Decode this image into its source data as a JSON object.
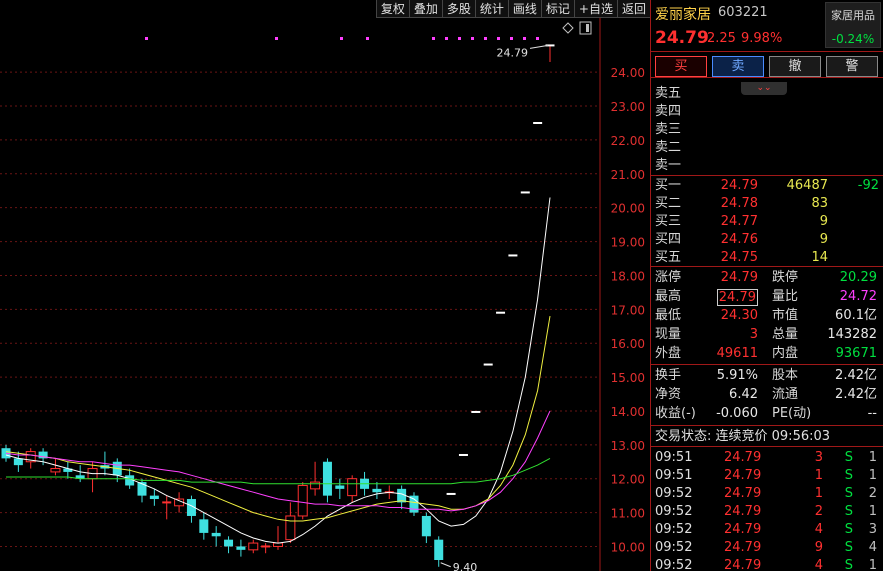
{
  "toolbar": [
    "复权",
    "叠加",
    "多股",
    "统计",
    "画线",
    "标记",
    "+自选",
    "返回"
  ],
  "stock": {
    "name": "爱丽家居",
    "code": "603221",
    "price": "24.79",
    "change": "2.25",
    "pct": "9.98%",
    "sector": "家居用品",
    "sector_change": "-0.24%"
  },
  "trade_buttons": [
    "买",
    "卖",
    "撤",
    "警"
  ],
  "asks": [
    {
      "label": "卖五",
      "price": "",
      "vol": "",
      "chg": ""
    },
    {
      "label": "卖四",
      "price": "",
      "vol": "",
      "chg": ""
    },
    {
      "label": "卖三",
      "price": "",
      "vol": "",
      "chg": ""
    },
    {
      "label": "卖二",
      "price": "",
      "vol": "",
      "chg": ""
    },
    {
      "label": "卖一",
      "price": "",
      "vol": "",
      "chg": ""
    }
  ],
  "bids": [
    {
      "label": "买一",
      "price": "24.79",
      "vol": "46487",
      "chg": "-92"
    },
    {
      "label": "买二",
      "price": "24.78",
      "vol": "83",
      "chg": ""
    },
    {
      "label": "买三",
      "price": "24.77",
      "vol": "9",
      "chg": ""
    },
    {
      "label": "买四",
      "price": "24.76",
      "vol": "9",
      "chg": ""
    },
    {
      "label": "买五",
      "price": "24.75",
      "vol": "14",
      "chg": ""
    }
  ],
  "stats": {
    "limit_up_label": "涨停",
    "limit_up": "24.79",
    "limit_down_label": "跌停",
    "limit_down": "20.29",
    "high_label": "最高",
    "high": "24.79",
    "vol_ratio_label": "量比",
    "vol_ratio": "24.72",
    "low_label": "最低",
    "low": "24.30",
    "mkt_cap_label": "市值",
    "mkt_cap": "60.1亿",
    "cur_vol_label": "现量",
    "cur_vol": "3",
    "total_vol_label": "总量",
    "total_vol": "143282",
    "outer_label": "外盘",
    "outer": "49611",
    "inner_label": "内盘",
    "inner": "93671"
  },
  "stats2": {
    "turnover_label": "换手",
    "turnover": "5.91%",
    "shares_label": "股本",
    "shares": "2.42亿",
    "nav_label": "净资",
    "nav": "6.42",
    "float_label": "流通",
    "float": "2.42亿",
    "eps_label": "收益(-)",
    "eps": "-0.060",
    "pe_label": "PE(动)",
    "pe": "--"
  },
  "status_line": "交易状态: 连续竞价 09:56:03",
  "ticks": [
    {
      "time": "09:51",
      "price": "24.79",
      "vol": "3",
      "side": "S",
      "num": "1"
    },
    {
      "time": "09:51",
      "price": "24.79",
      "vol": "1",
      "side": "S",
      "num": "1"
    },
    {
      "time": "09:52",
      "price": "24.79",
      "vol": "1",
      "side": "S",
      "num": "2"
    },
    {
      "time": "09:52",
      "price": "24.79",
      "vol": "2",
      "side": "S",
      "num": "1"
    },
    {
      "time": "09:52",
      "price": "24.79",
      "vol": "4",
      "side": "S",
      "num": "3"
    },
    {
      "time": "09:52",
      "price": "24.79",
      "vol": "9",
      "side": "S",
      "num": "4"
    },
    {
      "time": "09:52",
      "price": "24.79",
      "vol": "4",
      "side": "S",
      "num": "1"
    }
  ],
  "colors": {
    "up": "#ff3030",
    "down": "#3fe0e0",
    "ma1": "#ffffff",
    "ma2": "#f0f040",
    "ma3": "#ff40ff",
    "ma4": "#30e030"
  },
  "chart_data": {
    "type": "candlestick",
    "y_ticks": [
      "24.00",
      "23.00",
      "22.00",
      "21.00",
      "20.00",
      "19.00",
      "18.00",
      "17.00",
      "16.00",
      "15.00",
      "14.00",
      "13.00",
      "12.00",
      "11.00",
      "10.00"
    ],
    "ylim": [
      9.6,
      24.95
    ],
    "annotations": {
      "high": "24.79",
      "low": "9.40"
    },
    "candles": [
      {
        "o": 12.9,
        "c": 12.6,
        "h": 13.0,
        "l": 12.5
      },
      {
        "o": 12.6,
        "c": 12.4,
        "h": 12.8,
        "l": 12.2
      },
      {
        "o": 12.5,
        "c": 12.8,
        "h": 12.9,
        "l": 12.3
      },
      {
        "o": 12.8,
        "c": 12.6,
        "h": 12.9,
        "l": 12.4
      },
      {
        "o": 12.2,
        "c": 12.3,
        "h": 12.6,
        "l": 12.1
      },
      {
        "o": 12.3,
        "c": 12.2,
        "h": 12.5,
        "l": 12.0
      },
      {
        "o": 12.1,
        "c": 12.0,
        "h": 12.4,
        "l": 11.9
      },
      {
        "o": 12.0,
        "c": 12.3,
        "h": 12.5,
        "l": 11.6
      },
      {
        "o": 12.4,
        "c": 12.3,
        "h": 12.8,
        "l": 12.1
      },
      {
        "o": 12.5,
        "c": 12.1,
        "h": 12.6,
        "l": 11.9
      },
      {
        "o": 12.1,
        "c": 11.8,
        "h": 12.3,
        "l": 11.7
      },
      {
        "o": 11.9,
        "c": 11.5,
        "h": 12.0,
        "l": 11.3
      },
      {
        "o": 11.5,
        "c": 11.4,
        "h": 11.7,
        "l": 11.2
      },
      {
        "o": 11.3,
        "c": 11.3,
        "h": 11.5,
        "l": 10.8
      },
      {
        "o": 11.2,
        "c": 11.4,
        "h": 11.6,
        "l": 11.0
      },
      {
        "o": 11.4,
        "c": 10.9,
        "h": 11.5,
        "l": 10.7
      },
      {
        "o": 10.8,
        "c": 10.4,
        "h": 11.0,
        "l": 10.2
      },
      {
        "o": 10.4,
        "c": 10.3,
        "h": 10.6,
        "l": 10.0
      },
      {
        "o": 10.2,
        "c": 10.0,
        "h": 10.3,
        "l": 9.8
      },
      {
        "o": 10.0,
        "c": 9.9,
        "h": 10.2,
        "l": 9.7
      },
      {
        "o": 9.9,
        "c": 10.1,
        "h": 10.2,
        "l": 9.8
      },
      {
        "o": 10.0,
        "c": 10.0,
        "h": 10.1,
        "l": 9.8
      },
      {
        "o": 10.0,
        "c": 10.1,
        "h": 10.6,
        "l": 9.9
      },
      {
        "o": 10.2,
        "c": 10.9,
        "h": 11.3,
        "l": 10.1
      },
      {
        "o": 10.9,
        "c": 11.8,
        "h": 11.9,
        "l": 10.8
      },
      {
        "o": 11.7,
        "c": 11.9,
        "h": 12.5,
        "l": 11.5
      },
      {
        "o": 12.5,
        "c": 11.5,
        "h": 12.6,
        "l": 11.3
      },
      {
        "o": 11.8,
        "c": 11.7,
        "h": 12.0,
        "l": 11.4
      },
      {
        "o": 11.5,
        "c": 12.0,
        "h": 12.1,
        "l": 11.3
      },
      {
        "o": 12.0,
        "c": 11.7,
        "h": 12.2,
        "l": 11.5
      },
      {
        "o": 11.7,
        "c": 11.6,
        "h": 11.9,
        "l": 11.4
      },
      {
        "o": 11.6,
        "c": 11.6,
        "h": 11.8,
        "l": 11.4
      },
      {
        "o": 11.7,
        "c": 11.3,
        "h": 11.8,
        "l": 11.1
      },
      {
        "o": 11.5,
        "c": 11.0,
        "h": 11.6,
        "l": 10.9
      },
      {
        "o": 10.9,
        "c": 10.3,
        "h": 11.0,
        "l": 10.1
      },
      {
        "o": 10.2,
        "c": 9.6,
        "h": 10.3,
        "l": 9.4
      },
      {
        "o": 11.55,
        "c": 11.55,
        "h": 11.55,
        "l": 11.55
      },
      {
        "o": 12.7,
        "c": 12.7,
        "h": 12.7,
        "l": 12.7
      },
      {
        "o": 13.97,
        "c": 13.97,
        "h": 13.97,
        "l": 13.97
      },
      {
        "o": 15.37,
        "c": 15.37,
        "h": 15.37,
        "l": 15.37
      },
      {
        "o": 16.9,
        "c": 16.9,
        "h": 16.9,
        "l": 16.9
      },
      {
        "o": 18.59,
        "c": 18.59,
        "h": 18.59,
        "l": 18.59
      },
      {
        "o": 20.45,
        "c": 20.45,
        "h": 20.45,
        "l": 20.45
      },
      {
        "o": 22.5,
        "c": 22.5,
        "h": 22.5,
        "l": 22.5
      },
      {
        "o": 24.79,
        "c": 24.79,
        "h": 24.79,
        "l": 24.3
      }
    ],
    "ma": [
      {
        "name": "ma1",
        "values": [
          12.7,
          12.6,
          12.55,
          12.5,
          12.4,
          12.3,
          12.2,
          12.15,
          12.15,
          12.1,
          12.0,
          11.85,
          11.7,
          11.5,
          11.35,
          11.2,
          11.0,
          10.8,
          10.6,
          10.4,
          10.25,
          10.15,
          10.1,
          10.15,
          10.35,
          10.6,
          10.9,
          11.1,
          11.3,
          11.45,
          11.55,
          11.6,
          11.55,
          11.4,
          11.1,
          10.75,
          10.6,
          10.65,
          10.9,
          11.4,
          12.2,
          13.4,
          15.0,
          17.3,
          20.3
        ]
      },
      {
        "name": "ma2",
        "values": [
          12.8,
          12.75,
          12.7,
          12.65,
          12.6,
          12.5,
          12.45,
          12.4,
          12.35,
          12.3,
          12.25,
          12.15,
          12.05,
          11.95,
          11.85,
          11.75,
          11.6,
          11.45,
          11.3,
          11.15,
          11.0,
          10.9,
          10.8,
          10.75,
          10.75,
          10.8,
          10.85,
          10.95,
          11.05,
          11.15,
          11.25,
          11.3,
          11.35,
          11.3,
          11.25,
          11.2,
          11.1,
          11.1,
          11.2,
          11.4,
          11.8,
          12.4,
          13.3,
          14.6,
          16.8
        ]
      },
      {
        "name": "ma3",
        "values": [
          12.75,
          12.7,
          12.7,
          12.65,
          12.6,
          12.55,
          12.5,
          12.5,
          12.45,
          12.4,
          12.4,
          12.35,
          12.3,
          12.25,
          12.2,
          12.1,
          12.0,
          11.9,
          11.8,
          11.7,
          11.6,
          11.5,
          11.4,
          11.35,
          11.3,
          11.25,
          11.25,
          11.2,
          11.2,
          11.2,
          11.2,
          11.15,
          11.15,
          11.1,
          11.1,
          11.1,
          11.05,
          11.1,
          11.2,
          11.35,
          11.6,
          12.0,
          12.5,
          13.2,
          14.0
        ]
      },
      {
        "name": "ma4",
        "values": [
          12.05,
          12.05,
          12.05,
          12.05,
          12.05,
          12.05,
          12.0,
          12.0,
          12.0,
          12.0,
          12.0,
          11.95,
          11.95,
          11.95,
          11.95,
          11.9,
          11.9,
          11.9,
          11.9,
          11.9,
          11.85,
          11.85,
          11.85,
          11.85,
          11.85,
          11.85,
          11.85,
          11.85,
          11.85,
          11.85,
          11.85,
          11.85,
          11.85,
          11.85,
          11.85,
          11.85,
          11.85,
          11.9,
          11.9,
          11.95,
          12.0,
          12.1,
          12.25,
          12.4,
          12.6
        ]
      }
    ]
  }
}
